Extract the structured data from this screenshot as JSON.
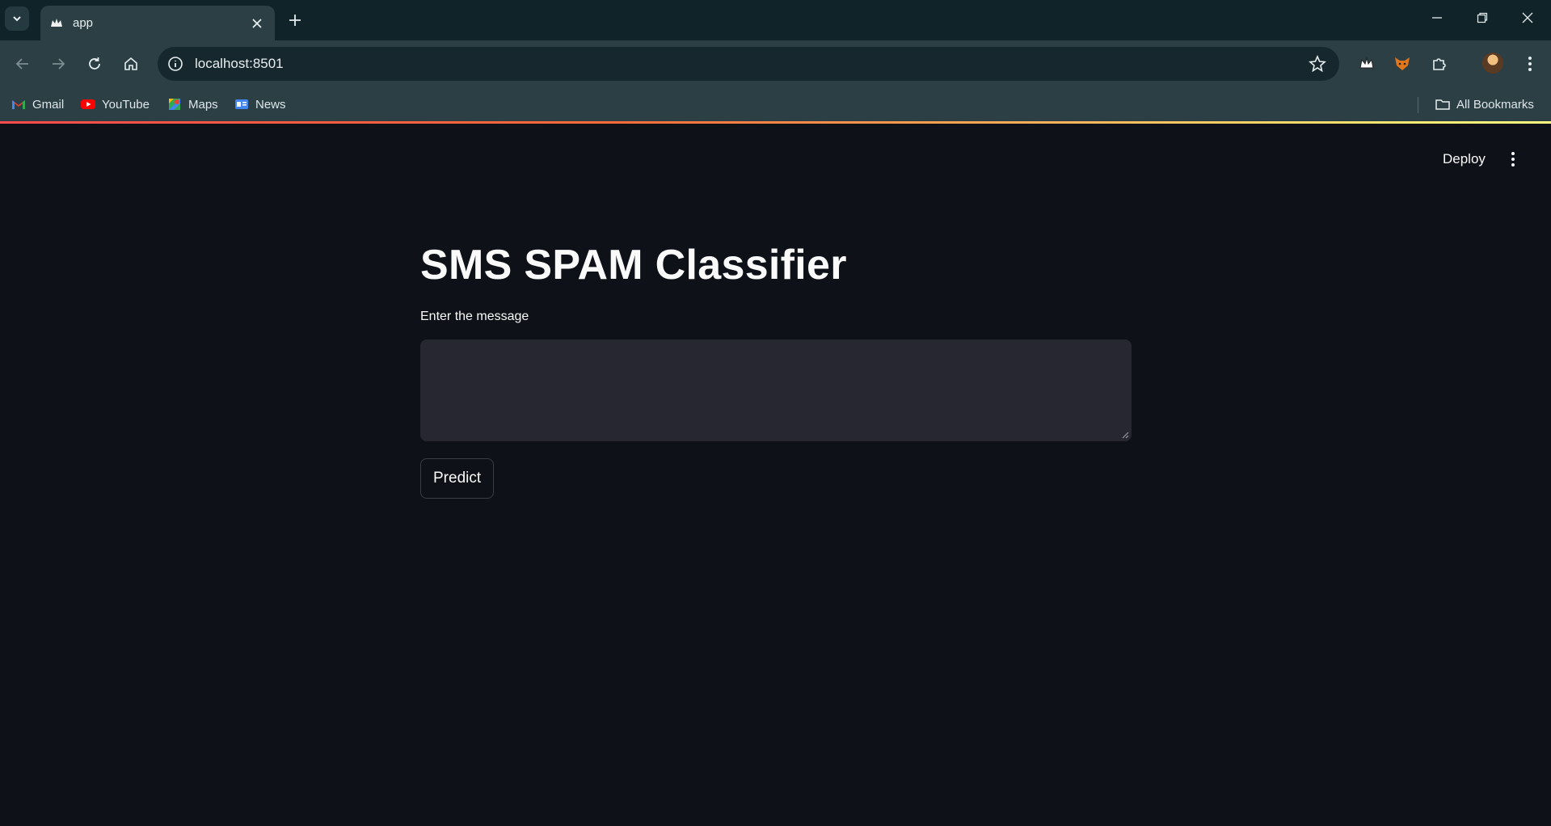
{
  "browser": {
    "tab": {
      "title": "app"
    },
    "address": {
      "url": "localhost:8501"
    },
    "bookmarks": [
      {
        "label": "Gmail",
        "icon": "gmail-icon"
      },
      {
        "label": "YouTube",
        "icon": "youtube-icon"
      },
      {
        "label": "Maps",
        "icon": "maps-icon"
      },
      {
        "label": "News",
        "icon": "news-icon"
      }
    ],
    "all_bookmarks_label": "All Bookmarks"
  },
  "app": {
    "deploy_label": "Deploy",
    "title": "SMS SPAM Classifier",
    "input": {
      "label": "Enter the message",
      "value": "",
      "placeholder": ""
    },
    "predict_label": "Predict"
  },
  "colors": {
    "background": "#0e1117",
    "textarea_bg": "#262730",
    "chrome_toolbar": "#2b3f45",
    "chrome_tabstrip": "#0f2328"
  }
}
